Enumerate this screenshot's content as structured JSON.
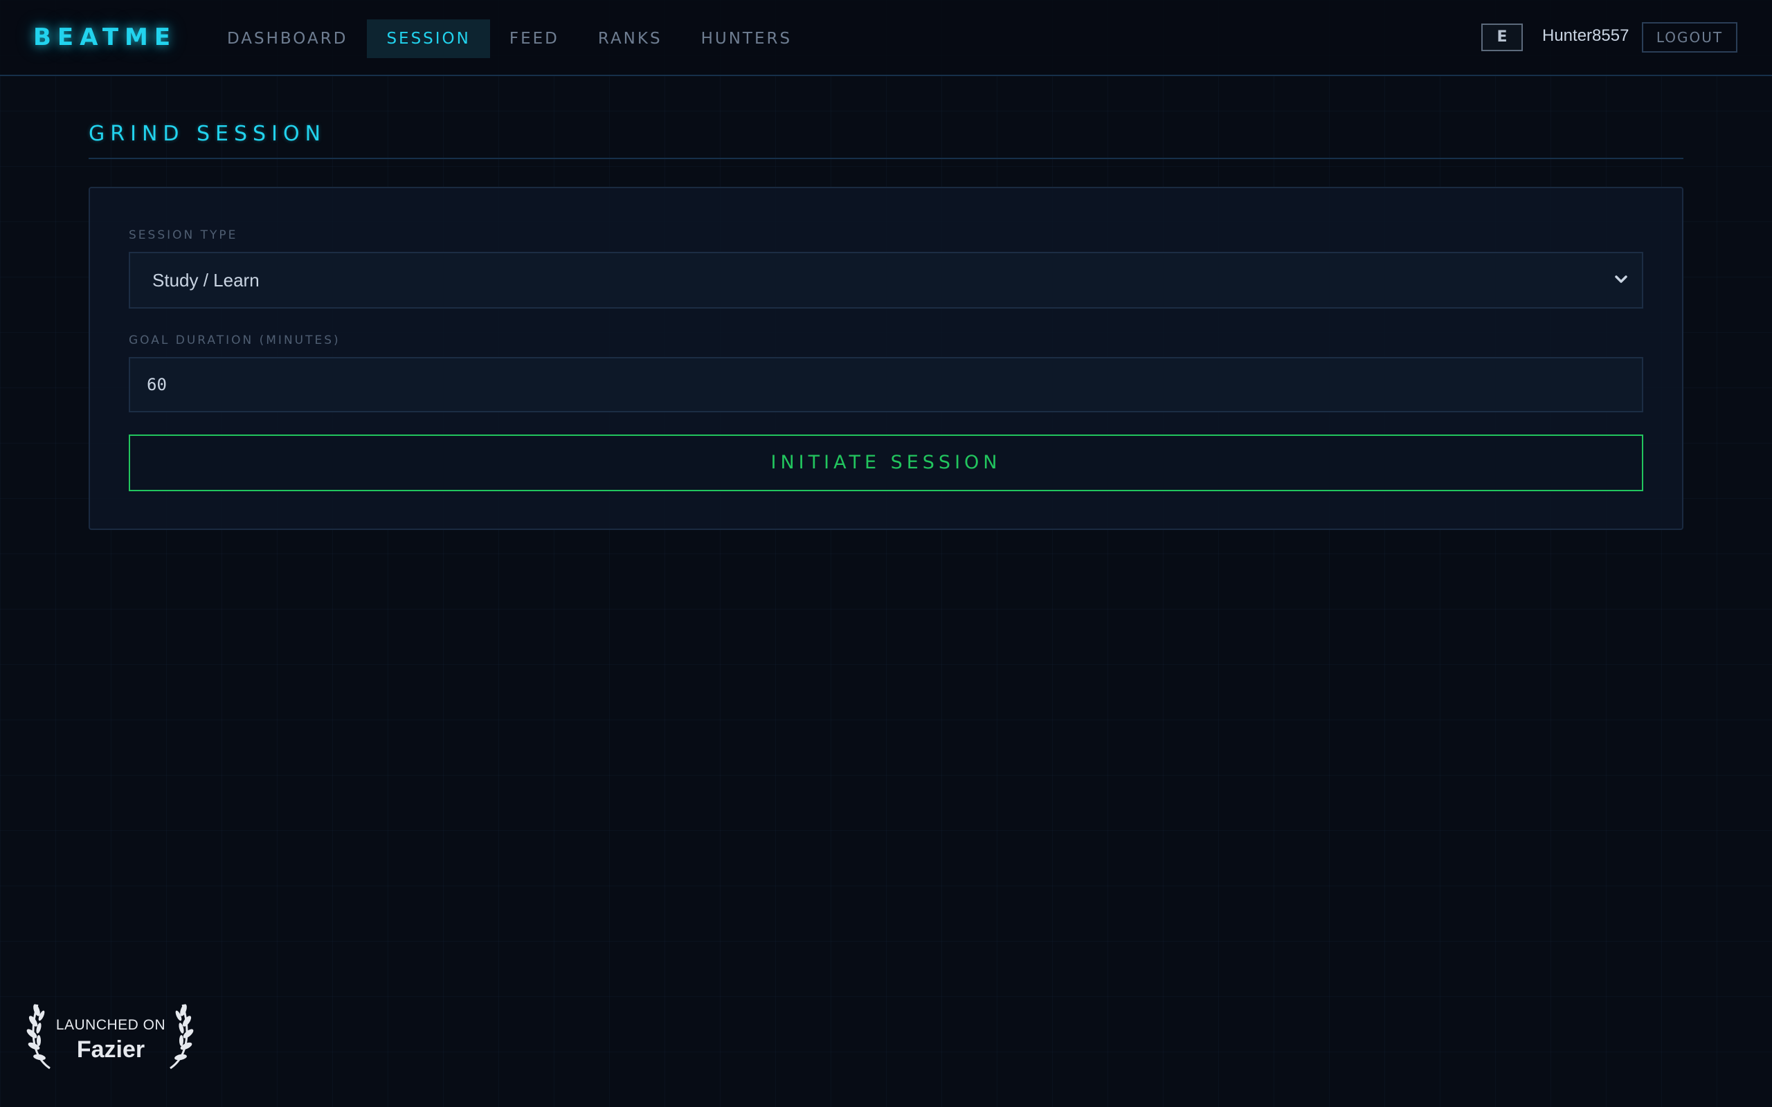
{
  "header": {
    "logo": "BEATME",
    "nav": [
      {
        "label": "DASHBOARD",
        "active": false
      },
      {
        "label": "SESSION",
        "active": true
      },
      {
        "label": "FEED",
        "active": false
      },
      {
        "label": "RANKS",
        "active": false
      },
      {
        "label": "HUNTERS",
        "active": false
      }
    ],
    "rank_badge": "E",
    "username": "Hunter8557",
    "logout_label": "LOGOUT"
  },
  "page": {
    "title": "GRIND SESSION"
  },
  "form": {
    "session_type_label": "SESSION TYPE",
    "session_type_value": "Study / Learn",
    "goal_label": "GOAL DURATION (MINUTES)",
    "goal_value": "60",
    "submit_label": "INITIATE SESSION"
  },
  "badge": {
    "small_text": "LAUNCHED ON",
    "big_text": "Fazier"
  },
  "colors": {
    "accent_cyan": "#22d3ee",
    "accent_green": "#22c55e",
    "background": "#070c15"
  }
}
